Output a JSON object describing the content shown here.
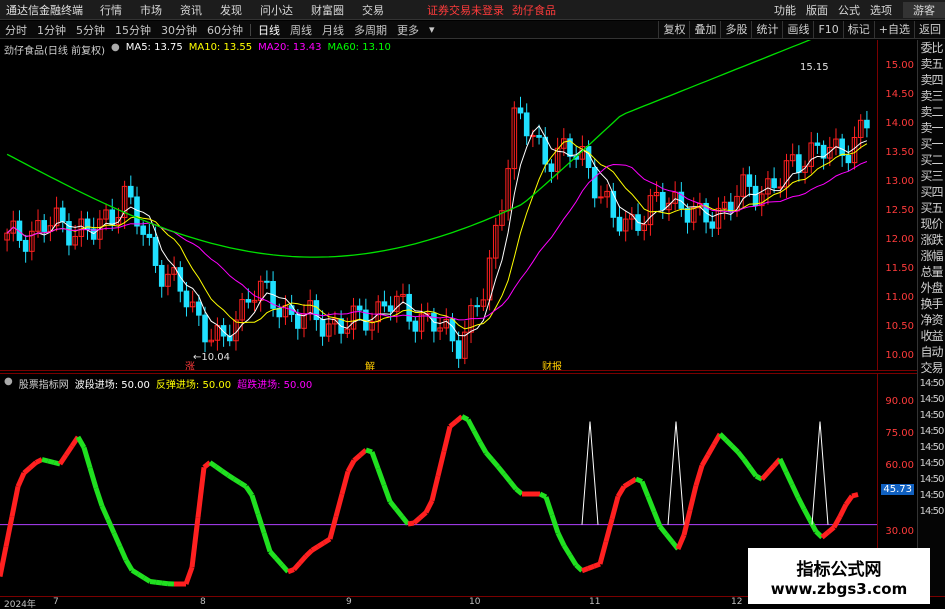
{
  "topbar": {
    "app_title": "通达信金融终端",
    "menu": [
      "行情",
      "市场",
      "资讯",
      "发现",
      "问小达",
      "财富圈",
      "交易"
    ],
    "notice": "证券交易未登录",
    "stock_name": "劲仔食品",
    "right_menu": [
      "功能",
      "版面",
      "公式",
      "选项"
    ],
    "guest": "游客"
  },
  "periodbar": {
    "periods": [
      "分时",
      "1分钟",
      "5分钟",
      "15分钟",
      "30分钟",
      "60分钟",
      "日线",
      "周线",
      "月线",
      "多周期",
      "更多"
    ],
    "active_period": "日线",
    "tools": [
      "复权",
      "叠加",
      "多股",
      "统计",
      "画线",
      "F10",
      "标记",
      "+自选",
      "返回"
    ]
  },
  "main_chart": {
    "title": "劲仔食品(日线 前复权)",
    "ma": [
      {
        "label": "MA5: 13.75",
        "color": "#ffffff"
      },
      {
        "label": "MA10: 13.55",
        "color": "#ffff00"
      },
      {
        "label": "MA20: 13.43",
        "color": "#ff00ff"
      },
      {
        "label": "MA60: 13.10",
        "color": "#00ff00"
      }
    ],
    "high_label": "15.15",
    "low_label": "10.04",
    "marker_zhang": "涨",
    "marker_jie": "解",
    "marker_caibao": "财报",
    "y_ticks": [
      "15.00",
      "14.50",
      "14.00",
      "13.50",
      "13.00",
      "12.50",
      "12.00",
      "11.50",
      "11.00",
      "10.50",
      "10.00"
    ]
  },
  "sub_chart": {
    "title": "股票指标网",
    "items": [
      {
        "label": "波段进场: 50.00",
        "color": "#ffffff"
      },
      {
        "label": "反弹进场: 50.00",
        "color": "#ffff00"
      },
      {
        "label": "超跌进场: 50.00",
        "color": "#ff00ff"
      }
    ],
    "y_ticks": [
      "90.00",
      "75.00",
      "60.00",
      "45.73",
      "30.00"
    ],
    "current_value": "45.73"
  },
  "right_panel": [
    "委比",
    "卖五",
    "卖四",
    "卖三",
    "卖二",
    "卖一",
    "买一",
    "买二",
    "买三",
    "买四",
    "买五",
    "现价",
    "涨跌",
    "涨幅",
    "总量",
    "外盘",
    "换手",
    "净资",
    "收益",
    "自动",
    "交易",
    "14:50",
    "14:50",
    "14:50",
    "14:50",
    "14:50",
    "14:50",
    "14:50",
    "14:50",
    "14:50"
  ],
  "date_axis": [
    {
      "label": "2024年",
      "pos": 0.005
    },
    {
      "label": "7",
      "pos": 0.06
    },
    {
      "label": "8",
      "pos": 0.228
    },
    {
      "label": "9",
      "pos": 0.394
    },
    {
      "label": "10",
      "pos": 0.535
    },
    {
      "label": "11",
      "pos": 0.672
    },
    {
      "label": "12",
      "pos": 0.833
    }
  ],
  "watermark": {
    "line1": "指标公式网",
    "line2": "www.zbgs3.com"
  },
  "colors": {
    "up": "#ff2020",
    "down": "#20e0ff",
    "bg": "#000000",
    "frame": "#7a0000"
  }
}
